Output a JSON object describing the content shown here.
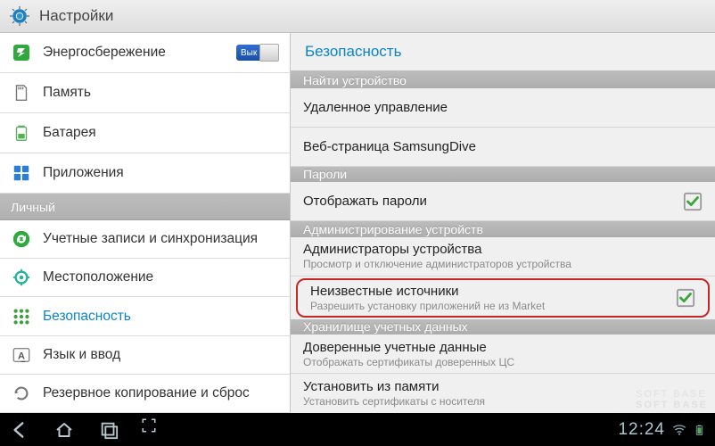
{
  "header": {
    "title": "Настройки"
  },
  "left": {
    "section_personal": "Личный",
    "items": [
      {
        "label": "Энергосбережение",
        "toggle_label": "Вык"
      },
      {
        "label": "Память"
      },
      {
        "label": "Батарея"
      },
      {
        "label": "Приложения"
      },
      {
        "label": "Учетные записи и синхронизация"
      },
      {
        "label": "Местоположение"
      },
      {
        "label": "Безопасность"
      },
      {
        "label": "Язык и ввод"
      },
      {
        "label": "Резервное копирование и сброс"
      }
    ]
  },
  "right": {
    "title": "Безопасность",
    "sections": {
      "find_device": "Найти устройство",
      "passwords": "Пароли",
      "admin": "Администрирование устройств",
      "credentials": "Хранилище учетных данных"
    },
    "items": {
      "remote_management": "Удаленное управление",
      "samsung_dive": "Веб-страница SamsungDive",
      "show_passwords": "Отображать пароли",
      "device_admins": {
        "primary": "Администраторы устройства",
        "secondary": "Просмотр и отключение администраторов устройства"
      },
      "unknown_sources": {
        "primary": "Неизвестные источники",
        "secondary": "Разрешить установку приложений не из Market"
      },
      "trusted_creds": {
        "primary": "Доверенные учетные данные",
        "secondary": "Отображать сертификаты доверенных ЦС"
      },
      "install_from_storage": {
        "primary": "Установить из памяти",
        "secondary": "Установить сертификаты с носителя"
      }
    }
  },
  "statusbar": {
    "time": "12:24"
  },
  "watermark": {
    "line1": "SOFT   BASE",
    "line2": "SOFT   BASE"
  }
}
